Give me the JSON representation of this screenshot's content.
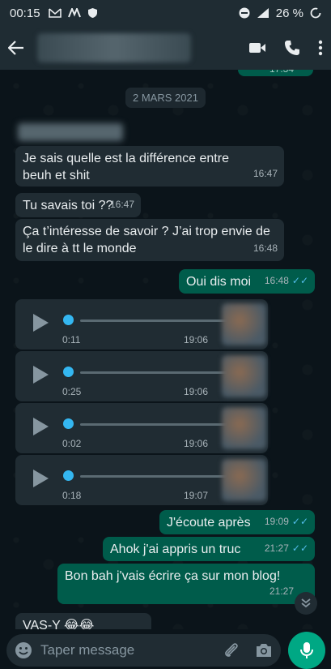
{
  "status_bar": {
    "time": "00:15",
    "battery": "26 %"
  },
  "chat": {
    "date_chip": "2 MARS 2021",
    "prev_time": "17:34",
    "messages": [
      {
        "text": "Je sais quelle est la différence entre beuh et shit",
        "time": "16:47",
        "dir": "in"
      },
      {
        "text": "Tu savais toi ??",
        "time": "16:47",
        "dir": "in"
      },
      {
        "text": "Ça t’intéresse de savoir ? J’ai trop envie de le dire à tt le monde",
        "time": "16:48",
        "dir": "in"
      },
      {
        "text": "Oui dis moi",
        "time": "16:48",
        "dir": "out"
      },
      {
        "text": "J'écoute après",
        "time": "19:09",
        "dir": "out"
      },
      {
        "text": "Ahok j'ai appris un truc",
        "time": "21:27",
        "dir": "out"
      },
      {
        "text": "Bon bah j'vais écrire ça sur mon blog!",
        "time": "21:27",
        "dir": "out"
      },
      {
        "text": "VAS-Y 😂😂",
        "time": "",
        "dir": "in"
      }
    ],
    "voice_notes": [
      {
        "duration": "0:11",
        "time": "19:06",
        "progress": 0
      },
      {
        "duration": "0:25",
        "time": "19:06",
        "progress": 0
      },
      {
        "duration": "0:02",
        "time": "19:06",
        "progress": 0
      },
      {
        "duration": "0:18",
        "time": "19:07",
        "progress": 0
      }
    ]
  },
  "input": {
    "placeholder": "Taper message"
  },
  "colors": {
    "incoming": "#202c33",
    "outgoing": "#005c4b",
    "accent": "#00a884",
    "read_ticks": "#53bdeb"
  }
}
